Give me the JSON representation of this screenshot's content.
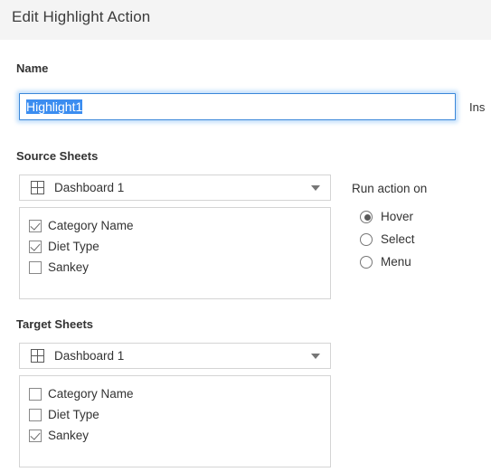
{
  "dialog": {
    "title": "Edit Highlight Action"
  },
  "name_field": {
    "label": "Name",
    "value": "Highlight1",
    "placeholder": "Name",
    "side_text": "Ins"
  },
  "source": {
    "label": "Source Sheets",
    "dropdown": {
      "value": "Dashboard 1",
      "icon": "dashboard-grid-icon",
      "caret_icon": "chevron-down-icon"
    },
    "sheets": [
      {
        "label": "Category Name",
        "checked": true
      },
      {
        "label": "Diet Type",
        "checked": true
      },
      {
        "label": "Sankey",
        "checked": false
      }
    ]
  },
  "target": {
    "label": "Target Sheets",
    "dropdown": {
      "value": "Dashboard 1",
      "icon": "dashboard-grid-icon",
      "caret_icon": "chevron-down-icon"
    },
    "sheets": [
      {
        "label": "Category Name",
        "checked": false
      },
      {
        "label": "Diet Type",
        "checked": false
      },
      {
        "label": "Sankey",
        "checked": true
      }
    ]
  },
  "run_action": {
    "label": "Run action on",
    "options": [
      {
        "label": "Hover",
        "selected": true
      },
      {
        "label": "Select",
        "selected": false
      },
      {
        "label": "Menu",
        "selected": false
      }
    ]
  },
  "colors": {
    "titlebar_bg": "#f4f4f4",
    "title_text": "#3c3c3c",
    "focus_border": "#3a87d9",
    "selection_bg": "#3b8df0",
    "border": "#d4d4d4",
    "text": "#333333"
  }
}
